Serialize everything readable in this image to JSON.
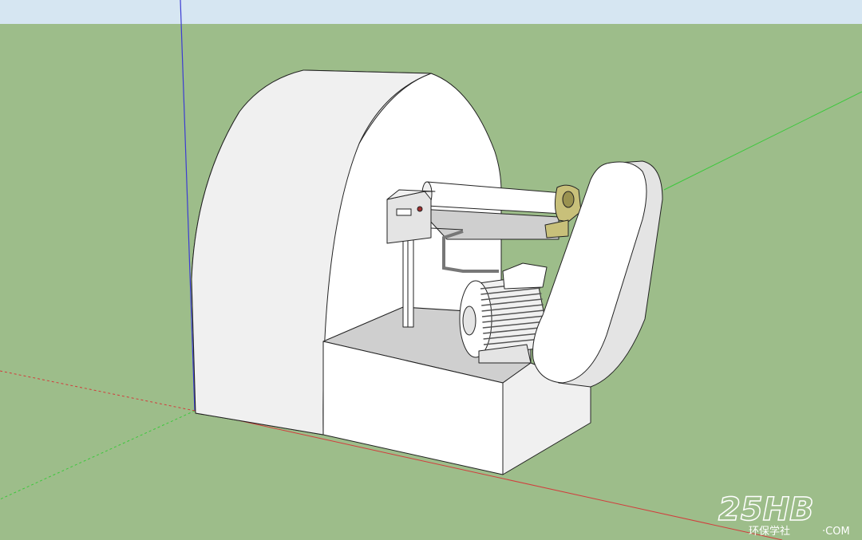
{
  "viewport": {
    "sky_color": "#d6e6f2",
    "ground_color": "#9dbd8a",
    "axis_red": "#d23c3c",
    "axis_green": "#3cc83c",
    "axis_blue": "#3c3cd2"
  },
  "model": {
    "body_color": "#ffffff",
    "edge_color": "#222222",
    "shade_light": "#f0f0f0",
    "shade_mid": "#e4e4e4",
    "shade_dark": "#cfcfcf",
    "bearing_color": "#c8c07a",
    "components": [
      {
        "name": "drum-housing",
        "icon": "drum-icon"
      },
      {
        "name": "base-block",
        "icon": "block-icon"
      },
      {
        "name": "roller-shaft",
        "icon": "cylinder-icon"
      },
      {
        "name": "bearing-block",
        "icon": "bearing-icon"
      },
      {
        "name": "control-box",
        "icon": "control-panel-icon"
      },
      {
        "name": "support-post",
        "icon": "post-icon"
      },
      {
        "name": "electric-motor",
        "icon": "motor-icon"
      },
      {
        "name": "belt-guard",
        "icon": "belt-guard-icon"
      },
      {
        "name": "pipe",
        "icon": "pipe-icon"
      }
    ]
  },
  "watermark": {
    "logo_text": "25HB",
    "site_text": "环保学社",
    "domain_suffix": "·COM"
  }
}
